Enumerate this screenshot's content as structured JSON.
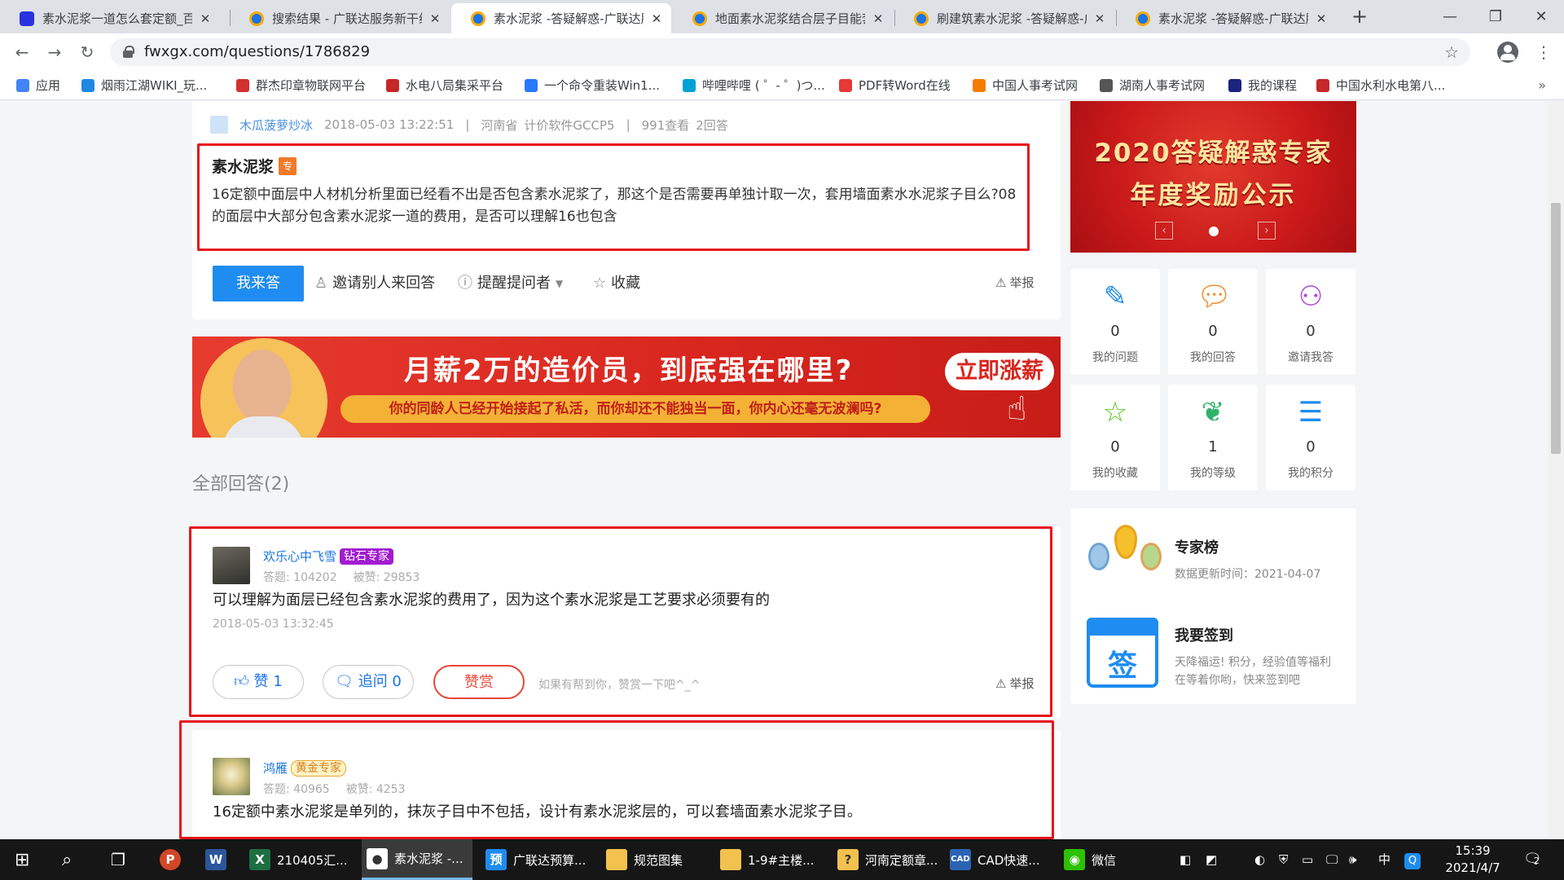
{
  "browser": {
    "tabs": [
      {
        "title": "素水泥浆一道怎么套定额_百度",
        "favicon": "baidu",
        "active": false
      },
      {
        "title": "搜索结果 - 广联达服务新干线",
        "favicon": "glodon",
        "active": false
      },
      {
        "title": "素水泥浆 -答疑解惑-广联达服务",
        "favicon": "glodon",
        "active": true
      },
      {
        "title": "地面素水泥浆结合层子目能套",
        "favicon": "glodon",
        "active": false
      },
      {
        "title": "刷建筑素水泥浆 -答疑解惑-广",
        "favicon": "glodon",
        "active": false
      },
      {
        "title": "素水泥浆 -答疑解惑-广联达服",
        "favicon": "glodon",
        "active": false
      }
    ],
    "url": "fwxgx.com/questions/1786829",
    "bookmarks": [
      {
        "label": "应用",
        "color": "#4285f4"
      },
      {
        "label": "烟雨江湖WIKI_玩...",
        "color": "#1e88e5"
      },
      {
        "label": "群杰印章物联网平台",
        "color": "#d32f2f"
      },
      {
        "label": "水电八局集采平台",
        "color": "#c62828"
      },
      {
        "label": "一个命令重装Win1...",
        "color": "#2979ff"
      },
      {
        "label": "哔哩哔哩 ( ゜- ゜)つ...",
        "color": "#00a1d6"
      },
      {
        "label": "PDF转Word在线",
        "color": "#e53935"
      },
      {
        "label": "中国人事考试网",
        "color": "#f57c00"
      },
      {
        "label": "湖南人事考试网",
        "color": "#555555"
      },
      {
        "label": "我的课程",
        "color": "#1a237e"
      },
      {
        "label": "中国水利水电第八...",
        "color": "#c62828"
      }
    ]
  },
  "question": {
    "author": "木瓜菠萝炒冰",
    "time": "2018-05-03 13:22:51",
    "sep1": "|",
    "location": "河南省",
    "software": "计价软件GCCP5",
    "sep2": "|",
    "views": "991查看",
    "answers": "2回答",
    "title": "素水泥浆",
    "tag": "专",
    "body": "16定额中面层中人材机分析里面已经看不出是否包含素水泥浆了，那这个是否需要再单独计取一次，套用墙面素水水泥浆子目么?08的面层中大部分包含素水泥浆一道的费用，是否可以理解16也包含",
    "answer_button": "我来答",
    "invite": "邀请别人来回答",
    "remind": "提醒提问者",
    "collect": "收藏",
    "report": "举报"
  },
  "banner": {
    "headline": "月薪2万的造价员，到底强在哪里?",
    "sub": "你的同龄人已经开始接起了私活，而你却还不能独当一面，你内心还毫无波澜吗?",
    "cta": "立即涨薪"
  },
  "answers_title": "全部回答(2)",
  "answers": [
    {
      "name": "欢乐心中飞雪",
      "badge": "钻石专家",
      "stats_answers": "答题:  104202",
      "stats_likes": "被赞:  29853",
      "text": "可以理解为面层已经包含素水泥浆的费用了，因为这个素水泥浆是工艺要求必须要有的",
      "time": "2018-05-03 13:32:45",
      "like": "赞 1",
      "ask": "追问  0",
      "reward": "赞赏",
      "hint": "如果有帮到你，赞赏一下吧^_^",
      "report": "举报"
    },
    {
      "name": "鸿雁",
      "badge": "黄金专家",
      "stats_answers": "答题:  40965",
      "stats_likes": "被赞:  4253",
      "text": "16定额中素水泥浆是单列的，抹灰子目中不包括，设计有素水泥浆层的，可以套墙面素水泥浆子目。"
    }
  ],
  "sidebar": {
    "ad_line1": "2020答疑解惑专家",
    "ad_line2": "年度奖励公示",
    "stats": [
      {
        "value": "0",
        "label": "我的问题",
        "icon": "edit-icon",
        "color": "#1e8cf0"
      },
      {
        "value": "0",
        "label": "我的回答",
        "icon": "chat-icon",
        "color": "#f08a2a"
      },
      {
        "value": "0",
        "label": "邀请我答",
        "icon": "user-add-icon",
        "color": "#b04ad8"
      },
      {
        "value": "0",
        "label": "我的收藏",
        "icon": "star-icon",
        "color": "#52c41a"
      },
      {
        "value": "1",
        "label": "我的等级",
        "icon": "leaf-icon",
        "color": "#2fb36b"
      },
      {
        "value": "0",
        "label": "我的积分",
        "icon": "coins-icon",
        "color": "#1e8cf0"
      }
    ],
    "experts_title": "专家榜",
    "experts_date": "数据更新时间：2021-04-07",
    "checkin_title": "我要签到",
    "checkin_desc": "天降福运! 积分，经验值等福利在等着你哟，快来签到吧",
    "checkin_icon_text": "签"
  },
  "taskbar": {
    "items": [
      {
        "label": "210405汇...",
        "color": "#1d6f42",
        "letter": "X"
      },
      {
        "label": "素水泥浆 -...",
        "color": "#ffffff",
        "letter": "●"
      },
      {
        "label": "广联达预算...",
        "color": "#1e8cf0",
        "letter": "预"
      },
      {
        "label": "规范图集",
        "color": "#f2c14e",
        "letter": ""
      },
      {
        "label": "1-9#主楼...",
        "color": "#f2c14e",
        "letter": ""
      },
      {
        "label": "河南定额章...",
        "color": "#f2c14e",
        "letter": "?"
      },
      {
        "label": "CAD快速...",
        "color": "#2b63b3",
        "letter": "CAD"
      },
      {
        "label": "微信",
        "color": "#2dc100",
        "letter": "◉"
      }
    ],
    "ime": "中",
    "time": "15:39",
    "date": "2021/4/7",
    "notifications": "2"
  }
}
